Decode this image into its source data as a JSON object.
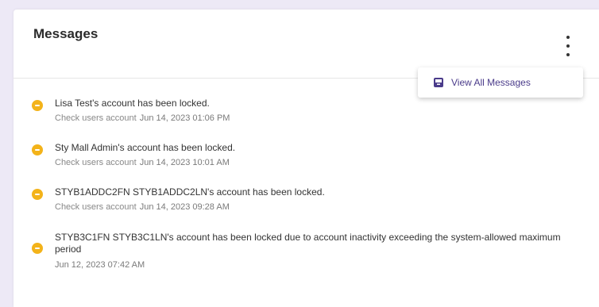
{
  "card": {
    "title": "Messages",
    "menu_icon": "kebab-vertical-icon",
    "dropdown": {
      "items": [
        {
          "icon": "inbox-icon",
          "label": "View All Messages"
        }
      ]
    }
  },
  "messages": [
    {
      "icon": "warning-circle-icon",
      "text": "Lisa Test's account has been locked.",
      "source": "Check users account",
      "timestamp": "Jun 14, 2023 01:06 PM"
    },
    {
      "icon": "warning-circle-icon",
      "text": "Sty Mall Admin's account has been locked.",
      "source": "Check users account",
      "timestamp": "Jun 14, 2023 10:01 AM"
    },
    {
      "icon": "warning-circle-icon",
      "text": "STYB1ADDC2FN STYB1ADDC2LN's account has been locked.",
      "source": "Check users account",
      "timestamp": "Jun 14, 2023 09:28 AM"
    },
    {
      "icon": "warning-circle-icon",
      "text": "STYB3C1FN STYB3C1LN's account has been locked due to account inactivity exceeding the system-allowed maximum period",
      "source": "",
      "timestamp": "Jun 12, 2023 07:42 AM"
    }
  ],
  "colors": {
    "background": "#ede9f6",
    "warning": "#f3b31a",
    "menu_accent": "#4a3b8a"
  }
}
